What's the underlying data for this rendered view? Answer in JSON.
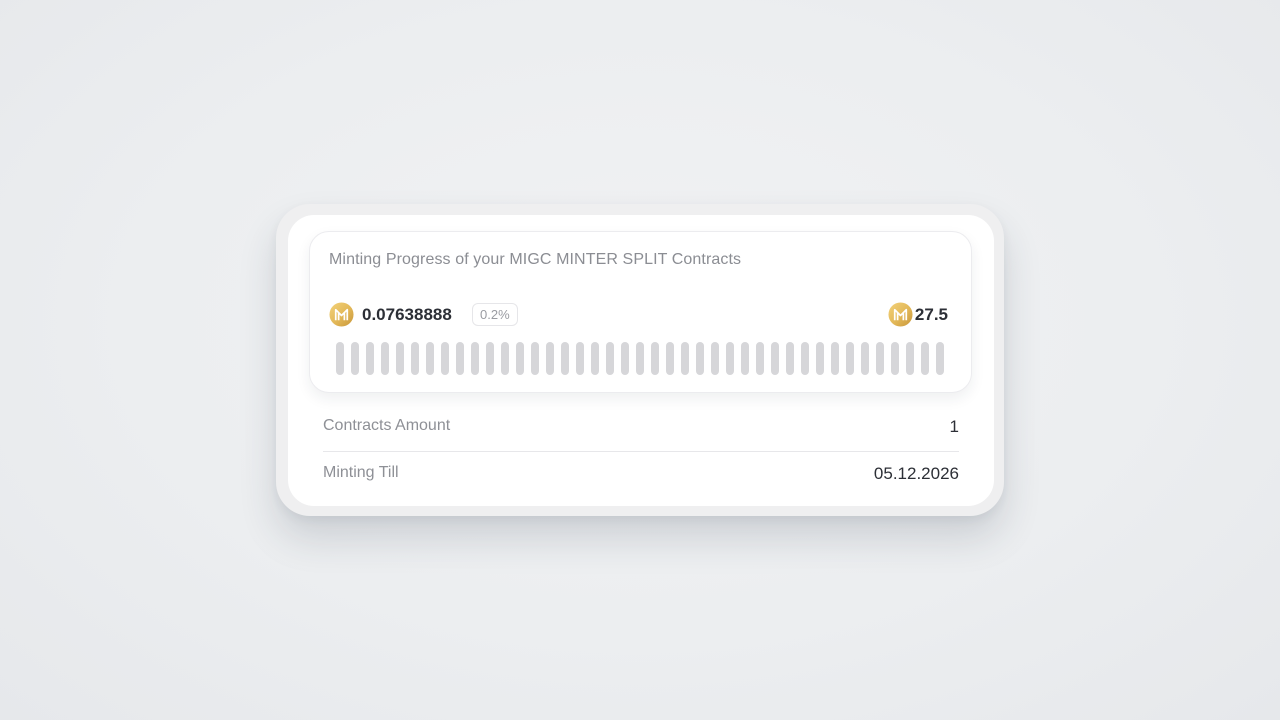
{
  "card": {
    "title": "Minting Progress of your MIGC MINTER SPLIT Contracts",
    "current_amount": "0.07638888",
    "percent_label": "0.2%",
    "total_amount": "27.5",
    "coin_icon": "migc-coin-icon",
    "progress": {
      "fraction": 0.002,
      "segment_count": 41,
      "empty_color": "#d6d6d9",
      "filled_color": "#e0b552"
    }
  },
  "details": [
    {
      "label": "Contracts Amount",
      "value": "1"
    },
    {
      "label": "Minting Till",
      "value": "05.12.2026"
    }
  ],
  "colors": {
    "coin_gold": "#e2b757",
    "text_primary": "#2c2f36",
    "text_muted": "#8b8d93"
  }
}
